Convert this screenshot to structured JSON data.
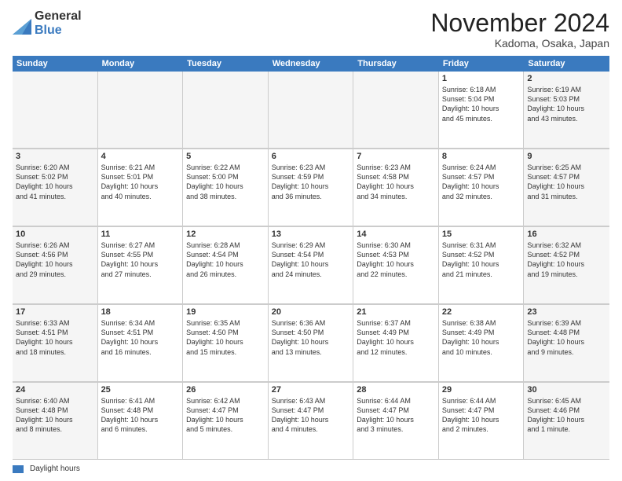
{
  "logo": {
    "general": "General",
    "blue": "Blue"
  },
  "title": "November 2024",
  "subtitle": "Kadoma, Osaka, Japan",
  "header_days": [
    "Sunday",
    "Monday",
    "Tuesday",
    "Wednesday",
    "Thursday",
    "Friday",
    "Saturday"
  ],
  "weeks": [
    [
      {
        "day": "",
        "info": "",
        "empty": true
      },
      {
        "day": "",
        "info": "",
        "empty": true
      },
      {
        "day": "",
        "info": "",
        "empty": true
      },
      {
        "day": "",
        "info": "",
        "empty": true
      },
      {
        "day": "",
        "info": "",
        "empty": true
      },
      {
        "day": "1",
        "info": "Sunrise: 6:18 AM\nSunset: 5:04 PM\nDaylight: 10 hours\nand 45 minutes."
      },
      {
        "day": "2",
        "info": "Sunrise: 6:19 AM\nSunset: 5:03 PM\nDaylight: 10 hours\nand 43 minutes."
      }
    ],
    [
      {
        "day": "3",
        "info": "Sunrise: 6:20 AM\nSunset: 5:02 PM\nDaylight: 10 hours\nand 41 minutes."
      },
      {
        "day": "4",
        "info": "Sunrise: 6:21 AM\nSunset: 5:01 PM\nDaylight: 10 hours\nand 40 minutes."
      },
      {
        "day": "5",
        "info": "Sunrise: 6:22 AM\nSunset: 5:00 PM\nDaylight: 10 hours\nand 38 minutes."
      },
      {
        "day": "6",
        "info": "Sunrise: 6:23 AM\nSunset: 4:59 PM\nDaylight: 10 hours\nand 36 minutes."
      },
      {
        "day": "7",
        "info": "Sunrise: 6:23 AM\nSunset: 4:58 PM\nDaylight: 10 hours\nand 34 minutes."
      },
      {
        "day": "8",
        "info": "Sunrise: 6:24 AM\nSunset: 4:57 PM\nDaylight: 10 hours\nand 32 minutes."
      },
      {
        "day": "9",
        "info": "Sunrise: 6:25 AM\nSunset: 4:57 PM\nDaylight: 10 hours\nand 31 minutes."
      }
    ],
    [
      {
        "day": "10",
        "info": "Sunrise: 6:26 AM\nSunset: 4:56 PM\nDaylight: 10 hours\nand 29 minutes."
      },
      {
        "day": "11",
        "info": "Sunrise: 6:27 AM\nSunset: 4:55 PM\nDaylight: 10 hours\nand 27 minutes."
      },
      {
        "day": "12",
        "info": "Sunrise: 6:28 AM\nSunset: 4:54 PM\nDaylight: 10 hours\nand 26 minutes."
      },
      {
        "day": "13",
        "info": "Sunrise: 6:29 AM\nSunset: 4:54 PM\nDaylight: 10 hours\nand 24 minutes."
      },
      {
        "day": "14",
        "info": "Sunrise: 6:30 AM\nSunset: 4:53 PM\nDaylight: 10 hours\nand 22 minutes."
      },
      {
        "day": "15",
        "info": "Sunrise: 6:31 AM\nSunset: 4:52 PM\nDaylight: 10 hours\nand 21 minutes."
      },
      {
        "day": "16",
        "info": "Sunrise: 6:32 AM\nSunset: 4:52 PM\nDaylight: 10 hours\nand 19 minutes."
      }
    ],
    [
      {
        "day": "17",
        "info": "Sunrise: 6:33 AM\nSunset: 4:51 PM\nDaylight: 10 hours\nand 18 minutes."
      },
      {
        "day": "18",
        "info": "Sunrise: 6:34 AM\nSunset: 4:51 PM\nDaylight: 10 hours\nand 16 minutes."
      },
      {
        "day": "19",
        "info": "Sunrise: 6:35 AM\nSunset: 4:50 PM\nDaylight: 10 hours\nand 15 minutes."
      },
      {
        "day": "20",
        "info": "Sunrise: 6:36 AM\nSunset: 4:50 PM\nDaylight: 10 hours\nand 13 minutes."
      },
      {
        "day": "21",
        "info": "Sunrise: 6:37 AM\nSunset: 4:49 PM\nDaylight: 10 hours\nand 12 minutes."
      },
      {
        "day": "22",
        "info": "Sunrise: 6:38 AM\nSunset: 4:49 PM\nDaylight: 10 hours\nand 10 minutes."
      },
      {
        "day": "23",
        "info": "Sunrise: 6:39 AM\nSunset: 4:48 PM\nDaylight: 10 hours\nand 9 minutes."
      }
    ],
    [
      {
        "day": "24",
        "info": "Sunrise: 6:40 AM\nSunset: 4:48 PM\nDaylight: 10 hours\nand 8 minutes."
      },
      {
        "day": "25",
        "info": "Sunrise: 6:41 AM\nSunset: 4:48 PM\nDaylight: 10 hours\nand 6 minutes."
      },
      {
        "day": "26",
        "info": "Sunrise: 6:42 AM\nSunset: 4:47 PM\nDaylight: 10 hours\nand 5 minutes."
      },
      {
        "day": "27",
        "info": "Sunrise: 6:43 AM\nSunset: 4:47 PM\nDaylight: 10 hours\nand 4 minutes."
      },
      {
        "day": "28",
        "info": "Sunrise: 6:44 AM\nSunset: 4:47 PM\nDaylight: 10 hours\nand 3 minutes."
      },
      {
        "day": "29",
        "info": "Sunrise: 6:44 AM\nSunset: 4:47 PM\nDaylight: 10 hours\nand 2 minutes."
      },
      {
        "day": "30",
        "info": "Sunrise: 6:45 AM\nSunset: 4:46 PM\nDaylight: 10 hours\nand 1 minute."
      }
    ]
  ],
  "footer": {
    "legend_label": "Daylight hours"
  }
}
